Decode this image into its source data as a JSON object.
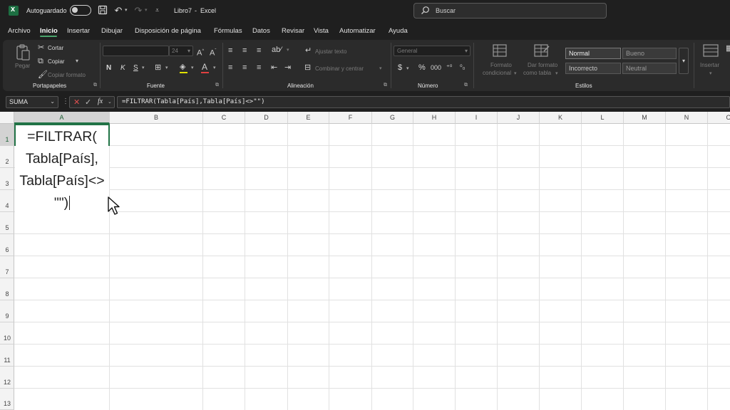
{
  "titlebar": {
    "autosave_label": "Autoguardado",
    "autosave_state": "off",
    "document_title": "Libro7",
    "separator": "-",
    "app_name": "Excel",
    "search_placeholder": "Buscar"
  },
  "menu": {
    "items": [
      "Archivo",
      "Inicio",
      "Insertar",
      "Dibujar",
      "Disposición de página",
      "Fórmulas",
      "Datos",
      "Revisar",
      "Vista",
      "Automatizar",
      "Ayuda"
    ],
    "active": "Inicio"
  },
  "ribbon": {
    "clipboard": {
      "label": "Portapapeles",
      "paste": "Pegar",
      "cut": "Cortar",
      "copy": "Copiar",
      "format_painter": "Copiar formato"
    },
    "font": {
      "label": "Fuente",
      "size": "24",
      "bold": "N",
      "italic": "K",
      "underline": "S"
    },
    "alignment": {
      "label": "Alineación",
      "wrap_text": "Ajustar texto",
      "merge_center": "Combinar y centrar"
    },
    "number": {
      "label": "Número",
      "format": "General",
      "currency": "$",
      "percent": "%"
    },
    "styles": {
      "label": "Estilos",
      "conditional_format": [
        "Formato",
        "condicional"
      ],
      "format_as_table": [
        "Dar formato",
        "como tabla"
      ],
      "cells": [
        "Normal",
        "Bueno",
        "Incorrecto",
        "Neutral"
      ]
    },
    "cells": {
      "insert": "Insertar"
    }
  },
  "formula_bar": {
    "name_box": "SUMA",
    "fx": "fx",
    "formula": "=FILTRAR(Tabla[País],Tabla[País]<>\"\")"
  },
  "grid": {
    "columns": [
      "A",
      "B",
      "C",
      "D",
      "E",
      "F",
      "G",
      "H",
      "I",
      "J",
      "K",
      "L",
      "M",
      "N",
      "O"
    ],
    "rows": [
      "1",
      "2",
      "3",
      "4",
      "5",
      "6",
      "7",
      "8",
      "9",
      "10",
      "11",
      "12",
      "13"
    ],
    "active_cell": "A1",
    "active_cell_lines": [
      "=FILTRAR(",
      "Tabla[País],",
      "Tabla[País]<>",
      "\"\")"
    ]
  }
}
